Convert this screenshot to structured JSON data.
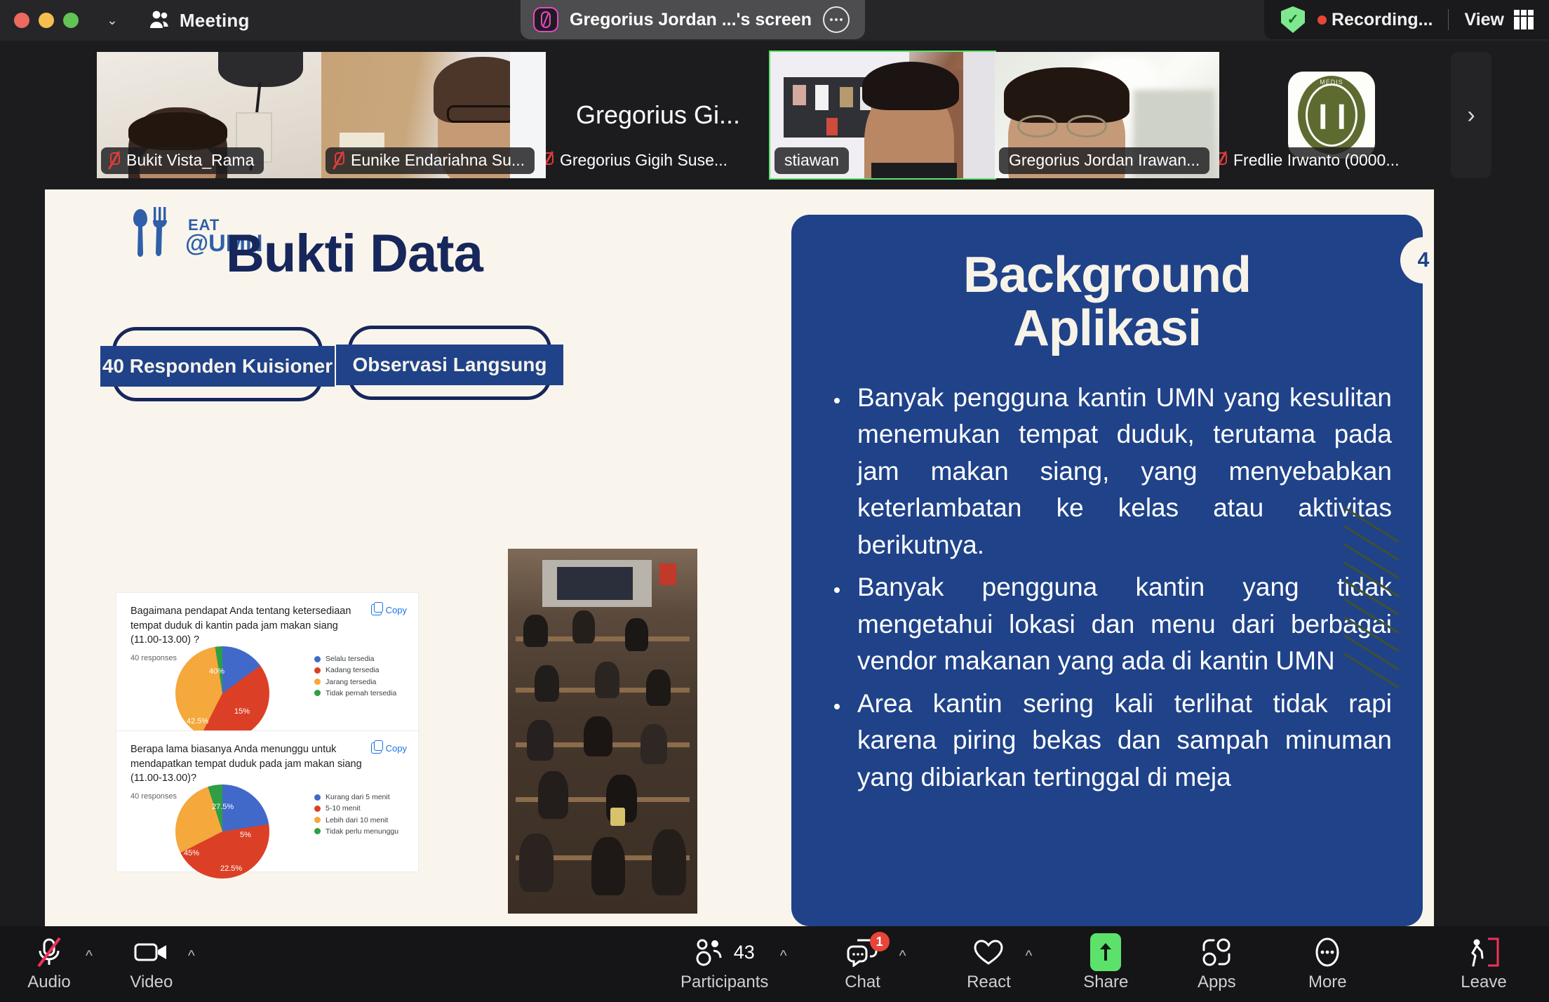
{
  "titlebar": {
    "window_controls": [
      "close",
      "minimize",
      "maximize"
    ],
    "chevron": "⌄",
    "meeting_label": "Meeting",
    "share_label": "Gregorius Jordan ...'s screen",
    "more_options": "•••",
    "encryption_icon": "shield-check",
    "recording_label": "Recording...",
    "view_label": "View"
  },
  "filmstrip": {
    "participants": [
      {
        "name": "Bukit Vista_Rama",
        "muted": true,
        "active": false,
        "video": true
      },
      {
        "name": "Eunike Endariahna Su...",
        "muted": true,
        "active": false,
        "video": true
      },
      {
        "name": "Gregorius Gigih Suse...",
        "muted": true,
        "active": false,
        "video": false,
        "placeholder": "Gregorius Gi..."
      },
      {
        "name": "stiawan",
        "muted": false,
        "active": true,
        "video": true
      },
      {
        "name": "Gregorius Jordan Irawan...",
        "muted": false,
        "active": false,
        "video": true
      },
      {
        "name": "Fredlie Irwanto (0000...",
        "muted": true,
        "active": false,
        "video": false,
        "avatar": "SARAYA MEDIS"
      }
    ],
    "next_arrow": "›"
  },
  "slide": {
    "logo_brand_eat": "EAT",
    "logo_brand_umn": "@UMN",
    "title": "Bukti Data",
    "pills": [
      "40 Responden Kuisioner",
      "Observasi Langsung"
    ],
    "page_number": "4",
    "panel_title_line1": "Background",
    "panel_title_line2": "Aplikasi",
    "bullets": [
      "Banyak pengguna kantin UMN yang kesulitan menemukan tempat duduk, terutama pada jam makan siang, yang menyebabkan keterlambatan ke kelas atau aktivitas berikutnya.",
      "Banyak pengguna kantin yang tidak mengetahui lokasi dan menu dari berbagai vendor makanan yang ada di kantin UMN",
      "Area kantin sering kali terlihat tidak rapi karena piring bekas dan sampah minuman yang dibiarkan tertinggal di meja"
    ],
    "colors": {
      "slide_bg": "#faf5ec",
      "navy": "#17275c",
      "panel_blue": "#1f4289",
      "cream": "#f7f3e8"
    }
  },
  "chart_data": [
    {
      "type": "pie",
      "title": "Bagaimana pendapat Anda tentang ketersediaan tempat duduk di kantin pada jam makan siang (11.00-13.00) ?",
      "subtitle": "40 responses",
      "copy_label": "Copy",
      "categories": [
        "Selalu tersedia",
        "Kadang tersedia",
        "Jarang tersedia",
        "Tidak pernah tersedia"
      ],
      "values": [
        15,
        42.5,
        40,
        2.5
      ],
      "value_labels": [
        "15%",
        "42.5%",
        "40%",
        ""
      ],
      "colors": [
        "#4169c9",
        "#db4026",
        "#f5a83b",
        "#2f9e44"
      ],
      "legend_position": "right",
      "unit": "%"
    },
    {
      "type": "pie",
      "title": "Berapa lama biasanya Anda menunggu untuk mendapatkan tempat duduk pada jam makan siang (11.00-13.00)?",
      "subtitle": "40 responses",
      "copy_label": "Copy",
      "categories": [
        "Kurang dari 5 menit",
        "5-10 menit",
        "Lebih dari 10 menit",
        "Tidak perlu menunggu"
      ],
      "values": [
        22.5,
        45,
        27.5,
        5
      ],
      "value_labels": [
        "22.5%",
        "45%",
        "27.5%",
        "5%"
      ],
      "colors": [
        "#4169c9",
        "#db4026",
        "#f5a83b",
        "#2f9e44"
      ],
      "legend_position": "right",
      "unit": "%"
    }
  ],
  "toolbar": {
    "items": [
      {
        "label": "Audio",
        "icon": "microphone-muted-icon",
        "caret": "^"
      },
      {
        "label": "Video",
        "icon": "camera-icon",
        "caret": "^"
      },
      {
        "label": "Participants",
        "icon": "participants-icon",
        "count": "43",
        "caret": "^"
      },
      {
        "label": "Chat",
        "icon": "chat-icon",
        "badge": "1",
        "caret": "^"
      },
      {
        "label": "React",
        "icon": "heart-icon",
        "caret": "^"
      },
      {
        "label": "Share",
        "icon": "share-screen-icon"
      },
      {
        "label": "Apps",
        "icon": "apps-icon"
      },
      {
        "label": "More",
        "icon": "more-dots-icon"
      },
      {
        "label": "Leave",
        "icon": "leave-door-icon"
      }
    ]
  }
}
